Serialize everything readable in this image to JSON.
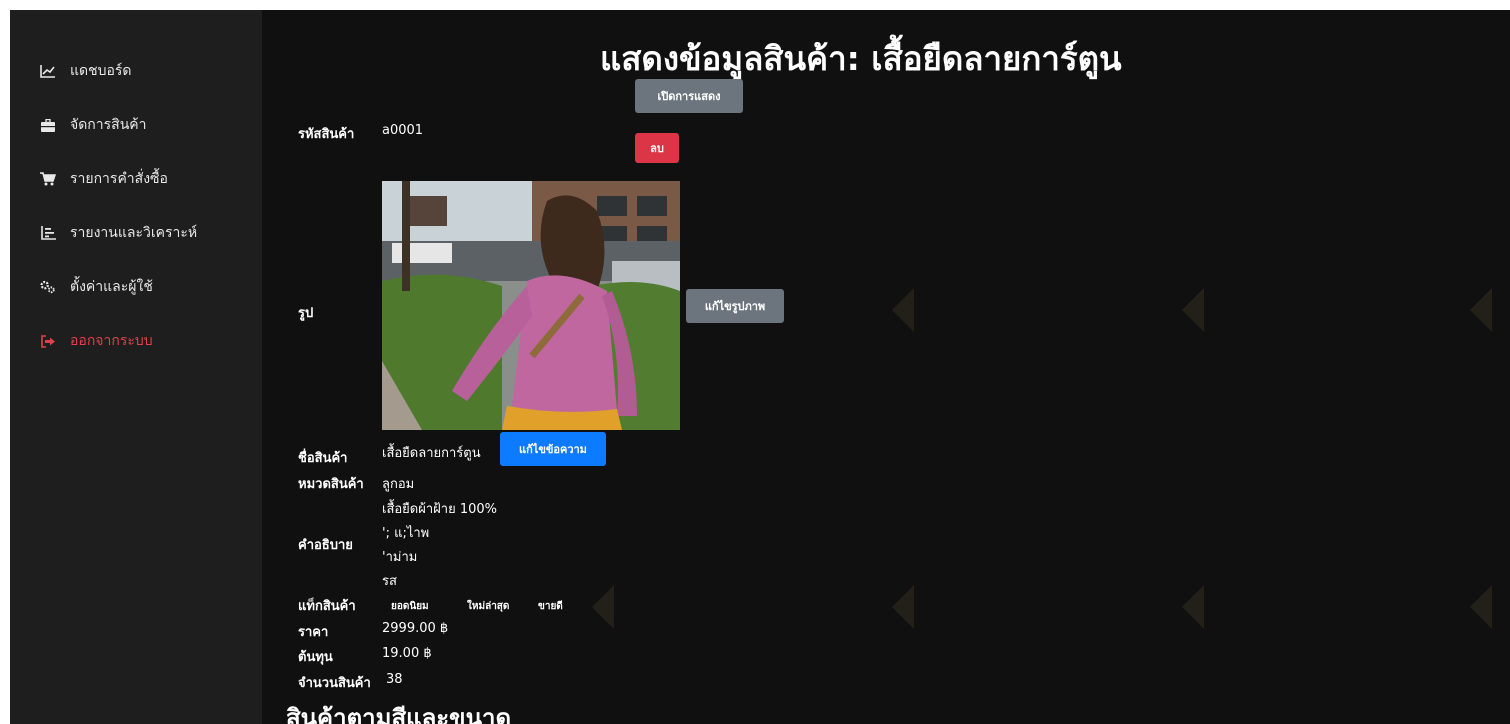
{
  "sidebar": {
    "items": [
      {
        "label": "แดชบอร์ด",
        "icon": "chart-line-icon"
      },
      {
        "label": "จัดการสินค้า",
        "icon": "briefcase-icon"
      },
      {
        "label": "รายการคำสั่งซื้อ",
        "icon": "cart-icon"
      },
      {
        "label": "รายงานและวิเคราะห์",
        "icon": "bar-chart-icon"
      },
      {
        "label": "ตั้งค่าและผู้ใช้",
        "icon": "gears-icon"
      },
      {
        "label": "ออกจากระบบ",
        "icon": "sign-out-icon"
      }
    ]
  },
  "page": {
    "title": "แสดงข้อมูลสินค้า: เสื้อยืดลายการ์ตูน",
    "toggle_display_label": "เปิดการแสดง",
    "delete_label": "ลบ",
    "edit_image_label": "แก้ไขรูปภาพ",
    "edit_text_label": "แก้ไขข้อความ"
  },
  "product": {
    "code_label": "รหัสสินค้า",
    "code": "a0001",
    "image_label": "รูป",
    "name_label": "ชื่อสินค้า",
    "name": "เสื้อยืดลายการ์ตูน",
    "category_label": "หมวดสินค้า",
    "category": "ลูกอม",
    "description_label": "คำอธิบาย",
    "description_lines": [
      "เสื้อยืดผ้าฝ้าย 100%",
      "'; แ;ไาพ",
      "'าม่าม",
      "รส"
    ],
    "tags_label": "แท็กสินค้า",
    "tags": [
      "ยอดนิยม",
      "ใหม่ล่าสุด",
      "ขายดี"
    ],
    "price_label": "ราคา",
    "price": "2999.00 ฿",
    "cost_label": "ต้นทุน",
    "cost": "19.00 ฿",
    "stock_label": "จำนวนสินค้า",
    "stock": "38"
  },
  "variants_section_title": "สินค้าตามสีและขนาด",
  "colors": {
    "sidebar_bg": "#1e1e1e",
    "main_bg": "#101010",
    "logout": "#e2404d",
    "btn_gray": "#6c757d",
    "btn_red": "#dc3545",
    "btn_blue": "#0d7bff"
  }
}
